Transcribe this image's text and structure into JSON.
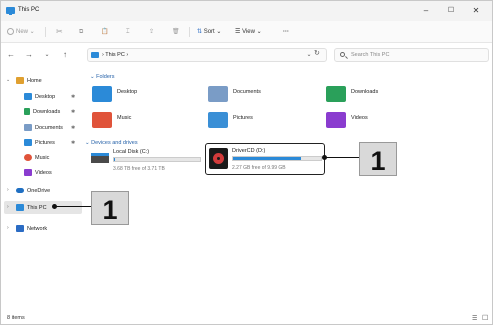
{
  "window": {
    "title": "This PC",
    "controls": [
      "–",
      "☐",
      "✕"
    ]
  },
  "toolbar": {
    "new_label": "New",
    "sort_label": "Sort",
    "view_label": "View",
    "more_label": "···"
  },
  "address": {
    "path": "This PC",
    "separator": "›",
    "search_placeholder": "Search This PC"
  },
  "sidebar": {
    "home": "Home",
    "quick": [
      {
        "label": "Desktop",
        "color": "#2b8ad8"
      },
      {
        "label": "Downloads",
        "color": "#2aa05a"
      },
      {
        "label": "Documents",
        "color": "#7a9cc6"
      },
      {
        "label": "Pictures",
        "color": "#2b8ad8"
      },
      {
        "label": "Music",
        "color": "#e0533a"
      },
      {
        "label": "Videos",
        "color": "#8a3ccf"
      }
    ],
    "onedrive": "OneDrive",
    "thispc": "This PC",
    "network": "Network"
  },
  "main": {
    "folders_heading": "Folders",
    "folders": [
      {
        "label": "Desktop",
        "color": "#2b8ad8"
      },
      {
        "label": "Documents",
        "color": "#7a9cc6"
      },
      {
        "label": "Downloads",
        "color": "#2aa05a"
      },
      {
        "label": "Music",
        "color": "#e0533a"
      },
      {
        "label": "Pictures",
        "color": "#3a8fd6"
      },
      {
        "label": "Videos",
        "color": "#8a3ccf"
      }
    ],
    "drives_heading": "Devices and drives",
    "drives": [
      {
        "name": "Local Disk (C:)",
        "free": "3.68 TB free of 3.71 TB",
        "used_fraction": 0.01
      },
      {
        "name": "DriverCD (D:)",
        "free": "2.27 GB free of 9.99 GB",
        "used_fraction": 0.77
      }
    ]
  },
  "callouts": {
    "one": "1",
    "two": "1"
  },
  "status": {
    "items": "8 items"
  }
}
